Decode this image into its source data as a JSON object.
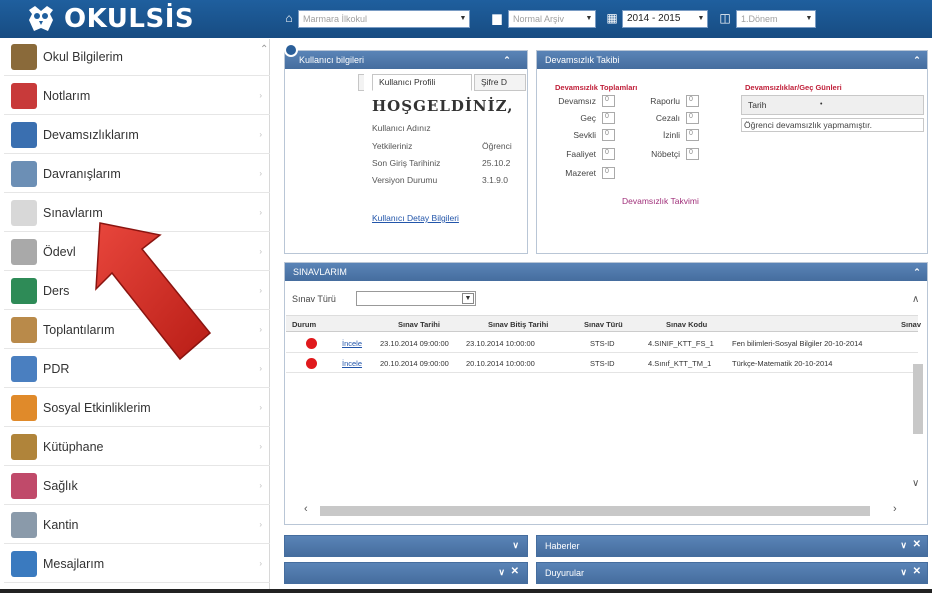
{
  "header": {
    "logo_text": "OKULSİS",
    "school_placeholder": "Marmara İlkokul",
    "search_placeholder": "Normal Arşiv",
    "year_value": "2014 - 2015",
    "term_placeholder": "1.Dönem"
  },
  "sidebar": {
    "items": [
      {
        "label": "Okul Bilgilerim"
      },
      {
        "label": "Notlarım"
      },
      {
        "label": "Devamsızlıklarım"
      },
      {
        "label": "Davranışlarım"
      },
      {
        "label": "Sınavlarım"
      },
      {
        "label": "Ödevl"
      },
      {
        "label": "Ders"
      },
      {
        "label": "Toplantılarım"
      },
      {
        "label": "PDR"
      },
      {
        "label": "Sosyal Etkinliklerim"
      },
      {
        "label": "Kütüphane"
      },
      {
        "label": "Sağlık"
      },
      {
        "label": "Kantin"
      },
      {
        "label": "Mesajlarım"
      }
    ]
  },
  "user_panel": {
    "title": "Kullanıcı bilgileri",
    "tab_profile": "Kullanıcı Profili",
    "tab_password": "Şifre D",
    "welcome": "HOŞGELDİNİZ,",
    "rows": [
      {
        "label": "Kullanıcı Adınız",
        "value": ""
      },
      {
        "label": "Yetkileriniz",
        "value": "Öğrenci"
      },
      {
        "label": "Son Giriş Tarihiniz",
        "value": "25.10.2"
      },
      {
        "label": "Versiyon Durumu",
        "value": "3.1.9.0"
      }
    ],
    "detail_link": "Kullanıcı Detay Bilgileri"
  },
  "devamsizlik": {
    "title": "Devamsızlık Takibi",
    "totals_title": "Devamsızlık Toplamları",
    "dates_title": "Devamsızlıklar/Geç Günleri",
    "left_fields": [
      {
        "label": "Devamsız",
        "value": "0"
      },
      {
        "label": "Geç",
        "value": "0"
      },
      {
        "label": "Sevkli",
        "value": "0"
      },
      {
        "label": "Faaliyet",
        "value": "0"
      },
      {
        "label": "Mazeret",
        "value": "0"
      }
    ],
    "right_fields": [
      {
        "label": "Raporlu",
        "value": "0"
      },
      {
        "label": "Cezalı",
        "value": "0"
      },
      {
        "label": "İzinli",
        "value": "0"
      },
      {
        "label": "Nöbetçi",
        "value": "0"
      }
    ],
    "calendar_link": "Devamsızlık Takvimi",
    "date_header": "Tarih",
    "empty_message": "Öğrenci devamsızlık yapmamıştır."
  },
  "sinavlar": {
    "title": "SINAVLARIM",
    "filter_label": "Sınav Türü",
    "columns": [
      "Durum",
      "Sınav Tarihi",
      "Sınav Bitiş Tarihi",
      "Sınav Türü",
      "Sınav Kodu",
      "Sınav"
    ],
    "rows": [
      {
        "link": "İncele",
        "start": "23.10.2014 09:00:00",
        "end": "23.10.2014 10:00:00",
        "type": "STS-ID",
        "code": "4.SINIF_KTT_FS_1",
        "name": "Fen bilimleri-Sosyal Bilgiler 20-10-2014"
      },
      {
        "link": "İncele",
        "start": "20.10.2014 09:00:00",
        "end": "20.10.2014 10:00:00",
        "type": "STS-ID",
        "code": "4.Sınıf_KTT_TM_1",
        "name": "Türkçe-Matematik 20-10-2014"
      }
    ]
  },
  "bottom_panels": {
    "news": "Haberler",
    "announcements": "Duyurular"
  },
  "colors": {
    "header_bg": "#1f5f9e",
    "panel_title": "#5a84b7",
    "status_red": "#e0191c",
    "arrow_red": "#d42a22"
  }
}
